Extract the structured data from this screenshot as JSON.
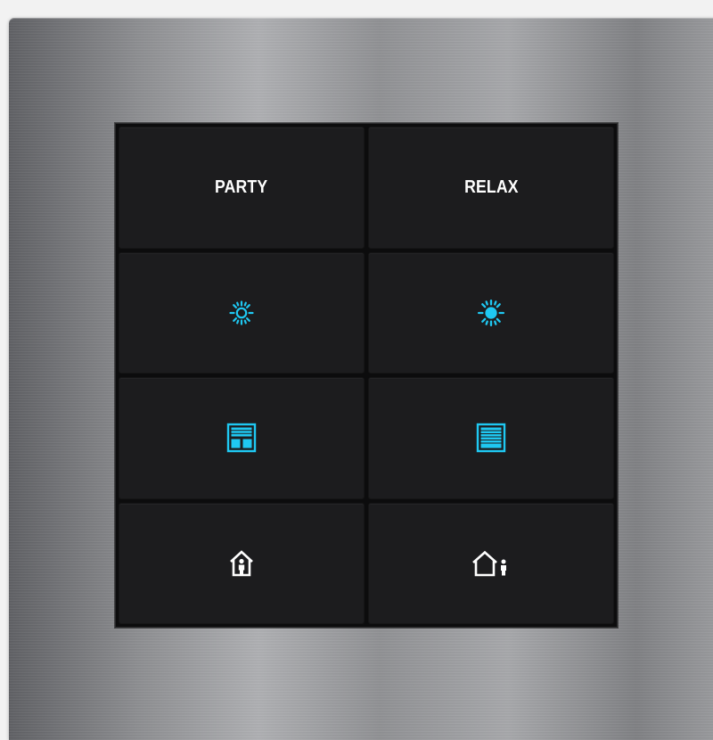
{
  "panel": {
    "keys": [
      {
        "label": "PARTY"
      },
      {
        "label": "RELAX"
      },
      {
        "icon": "sun-outline-icon"
      },
      {
        "icon": "sun-filled-icon"
      },
      {
        "icon": "blinds-split-icon"
      },
      {
        "icon": "blinds-full-icon"
      },
      {
        "icon": "home-person-inside-icon"
      },
      {
        "icon": "home-person-outside-icon"
      }
    ]
  },
  "colors": {
    "accent": "#1fc8f2",
    "label": "#ffffff",
    "key_bg": "#1c1c1e",
    "frame": "#0c0c0d"
  }
}
